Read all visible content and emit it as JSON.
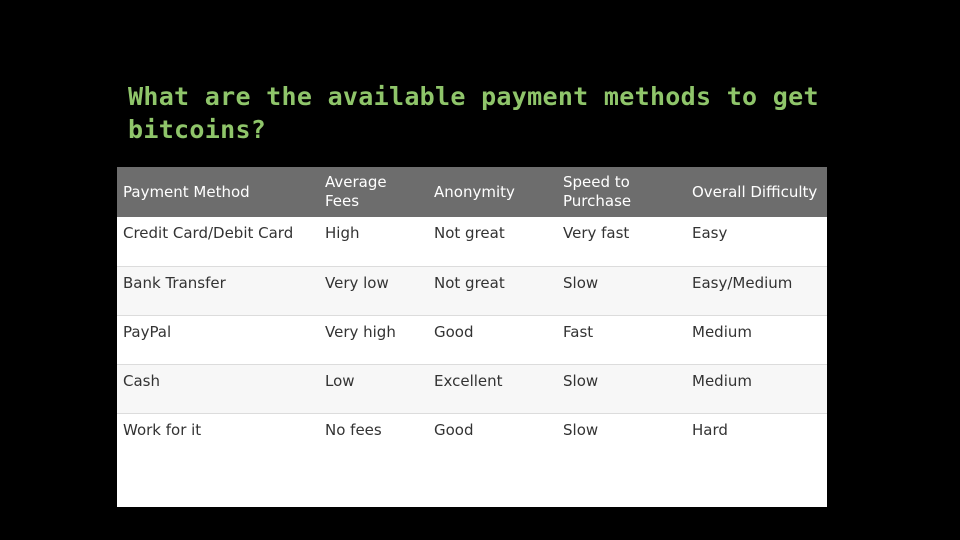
{
  "slide": {
    "title": "What are the available payment methods to get bitcoins?",
    "colors": {
      "background": "#000000",
      "title": "#8fc56a",
      "header_bg": "#6d6d6d",
      "alt_row": "#f7f7f7"
    }
  },
  "table": {
    "headers": [
      "Payment Method",
      "Average Fees",
      "Anonymity",
      "Speed to Purchase",
      "Overall Difficulty"
    ],
    "rows": [
      [
        "Credit Card/Debit Card",
        "High",
        "Not great",
        "Very fast",
        "Easy"
      ],
      [
        "Bank Transfer",
        "Very low",
        "Not great",
        "Slow",
        "Easy/Medium"
      ],
      [
        "PayPal",
        "Very high",
        "Good",
        "Fast",
        "Medium"
      ],
      [
        "Cash",
        "Low",
        "Excellent",
        "Slow",
        "Medium"
      ],
      [
        "Work for it",
        "No fees",
        "Good",
        "Slow",
        "Hard"
      ]
    ]
  }
}
